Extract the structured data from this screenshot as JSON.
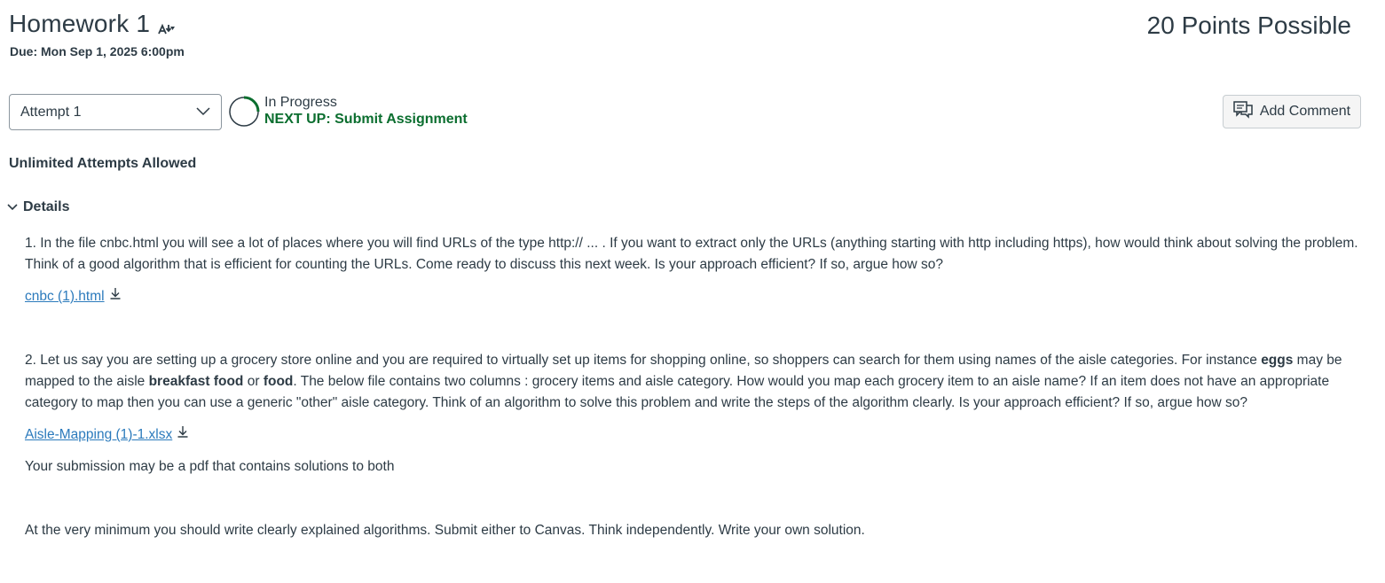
{
  "assignment": {
    "title": "Homework 1",
    "due": "Due: Mon Sep 1, 2025 6:00pm",
    "points": "20 Points Possible"
  },
  "attempt": {
    "selected": "Attempt 1",
    "status": "In Progress",
    "next_up": "NEXT UP: Submit Assignment",
    "allowed": "Unlimited Attempts Allowed"
  },
  "actions": {
    "add_comment": "Add Comment"
  },
  "details": {
    "toggle_label": "Details",
    "q1_text": "1. In the file cnbc.html you will see a lot of places where you will find URLs of the type http:// ... .  If you want to extract only the URLs (anything starting with http including https), how would think about solving the problem.  Think of a good algorithm that is efficient for counting the URLs.    Come ready to discuss this next week.  Is your approach efficient?  If so, argue how so?",
    "file1": "cnbc (1).html",
    "q2_part1": "2.  Let us say you are setting up a grocery store online and you are required to virtually set up items for shopping online, so shoppers can search for them using names of the aisle categories.  For instance ",
    "q2_bold1": "eggs",
    "q2_part2": " may be mapped to the aisle ",
    "q2_bold2": "breakfast food",
    "q2_part3": " or ",
    "q2_bold3": "food",
    "q2_part4": ".  The below file contains two columns : grocery items and aisle category.  How would you map each grocery item to an aisle name?  If an item does not have an appropriate category to map then you can use a generic \"other\" aisle category.  Think of an algorithm to solve this problem and write the steps of the algorithm clearly.   Is your approach efficient?  If so, argue how so?",
    "file2": "Aisle-Mapping (1)-1.xlsx",
    "submission_note": "Your submission may be a pdf that contains solutions to both",
    "minimum_note": "At the very minimum you should write clearly explained algorithms.  Submit either to Canvas.  Think independently.  Write your own solution."
  },
  "icons": {
    "title_icon": "immersive-reader-icon",
    "dropdown_icon": "chevron-down-icon",
    "status_icon": "progress-ring-icon",
    "comment_icon": "comment-icon",
    "details_icon": "chevron-down-icon",
    "download_icon": "download-icon"
  },
  "colors": {
    "text": "#2d3b45",
    "link": "#2b7abc",
    "success": "#0b6e2f"
  }
}
